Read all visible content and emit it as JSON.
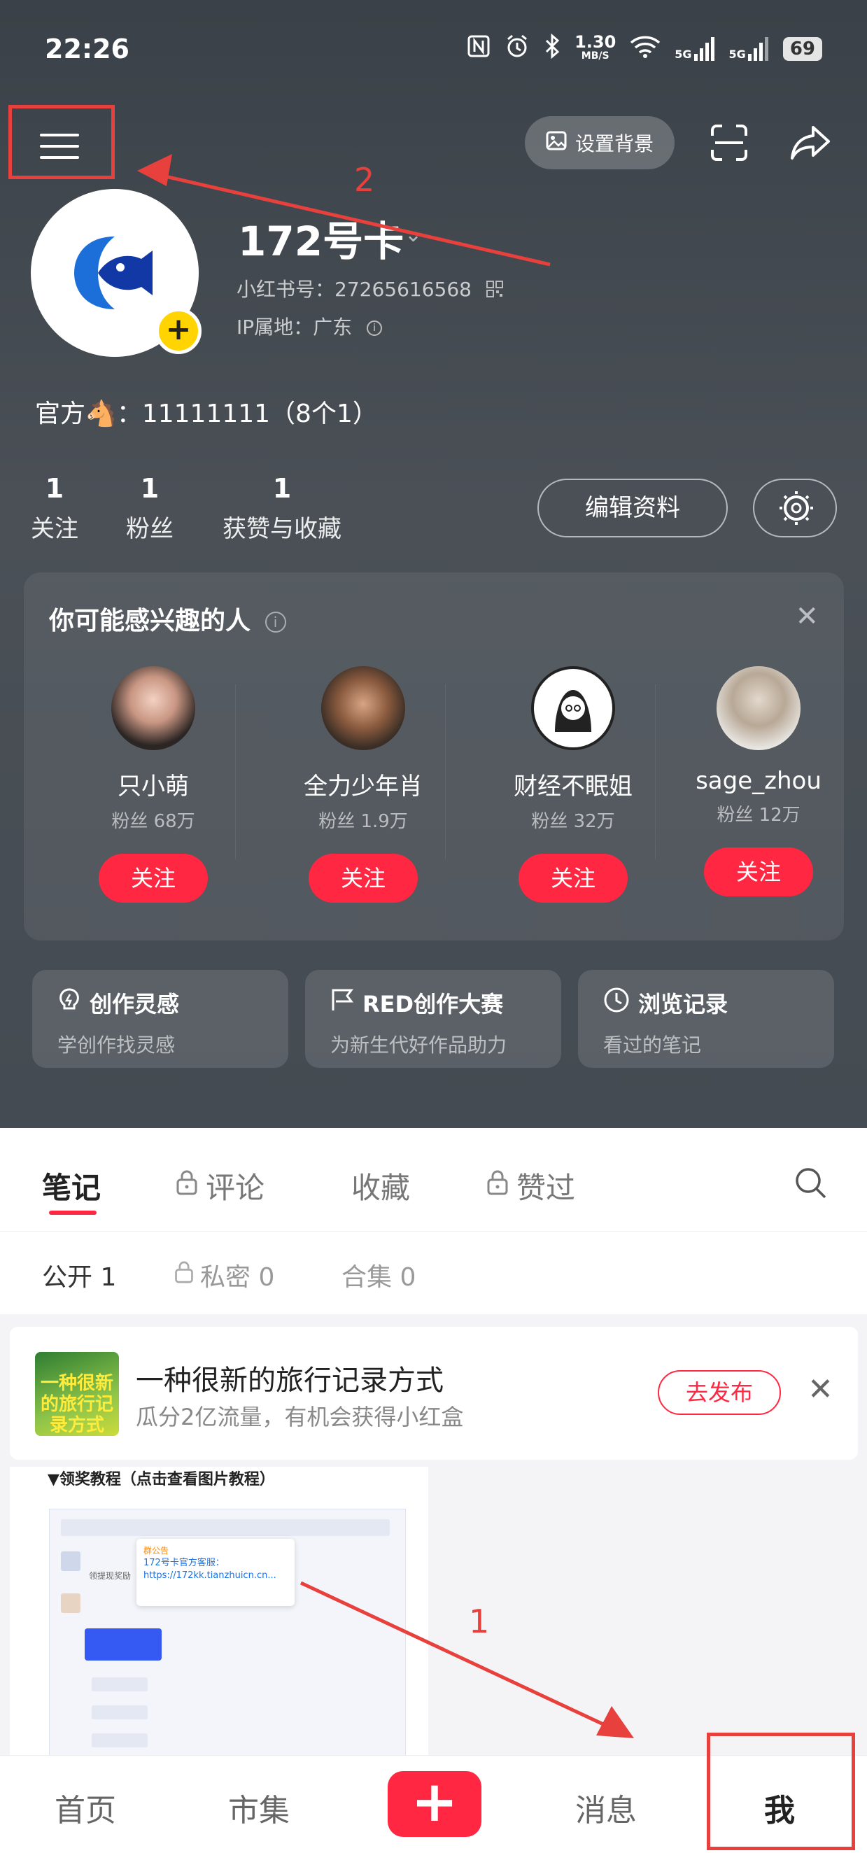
{
  "status_bar": {
    "time": "22:26",
    "net_speed_value": "1.30",
    "net_speed_unit": "MB/S",
    "battery": "69",
    "sim1": "5G",
    "sim2": "5G"
  },
  "header": {
    "set_background_label": "设置背景"
  },
  "profile": {
    "name": "172号卡",
    "id_label": "小红书号：27265616568",
    "ip_label": "IP属地：广东",
    "bio": "官方🐴：11111111（8个1）"
  },
  "stats": [
    {
      "value": "1",
      "label": "关注"
    },
    {
      "value": "1",
      "label": "粉丝"
    },
    {
      "value": "1",
      "label": "获赞与收藏"
    }
  ],
  "edit_profile_label": "编辑资料",
  "recommend": {
    "title": "你可能感兴趣的人",
    "people": [
      {
        "name": "只小萌",
        "fans": "粉丝 68万",
        "follow": "关注"
      },
      {
        "name": "全力少年肖",
        "fans": "粉丝 1.9万",
        "follow": "关注"
      },
      {
        "name": "财经不眠姐",
        "fans": "粉丝 32万",
        "follow": "关注"
      },
      {
        "name": "sage_zhou",
        "fans": "粉丝 12万",
        "follow": "关注"
      }
    ]
  },
  "quick_cards": [
    {
      "title": "创作灵感",
      "sub": "学创作找灵感"
    },
    {
      "title": "RED创作大赛",
      "sub": "为新生代好作品助力"
    },
    {
      "title": "浏览记录",
      "sub": "看过的笔记"
    }
  ],
  "tabs": [
    "笔记",
    "评论",
    "收藏",
    "赞过"
  ],
  "subtabs": [
    "公开 1",
    "私密 0",
    "合集 0"
  ],
  "promo": {
    "image_text": "一种很新的旅行记录方式",
    "title": "一种很新的旅行记录方式",
    "sub": "瓜分2亿流量，有机会获得小红盒",
    "button": "去发布"
  },
  "note": {
    "caption": "▼领奖教程（点击查看图片教程）",
    "popup_tag": "群公告",
    "popup_text": "172号卡官方客服：https://172kk.tianzhuicn.cn...",
    "side_label": "领提现奖励"
  },
  "annotations": {
    "one": "1",
    "two": "2"
  },
  "bottom_nav": {
    "home": "首页",
    "market": "市集",
    "messages": "消息",
    "me": "我"
  },
  "colors": {
    "accent": "#ff2741",
    "annotation": "#e8413d",
    "follow_badge": "#ffd400"
  }
}
